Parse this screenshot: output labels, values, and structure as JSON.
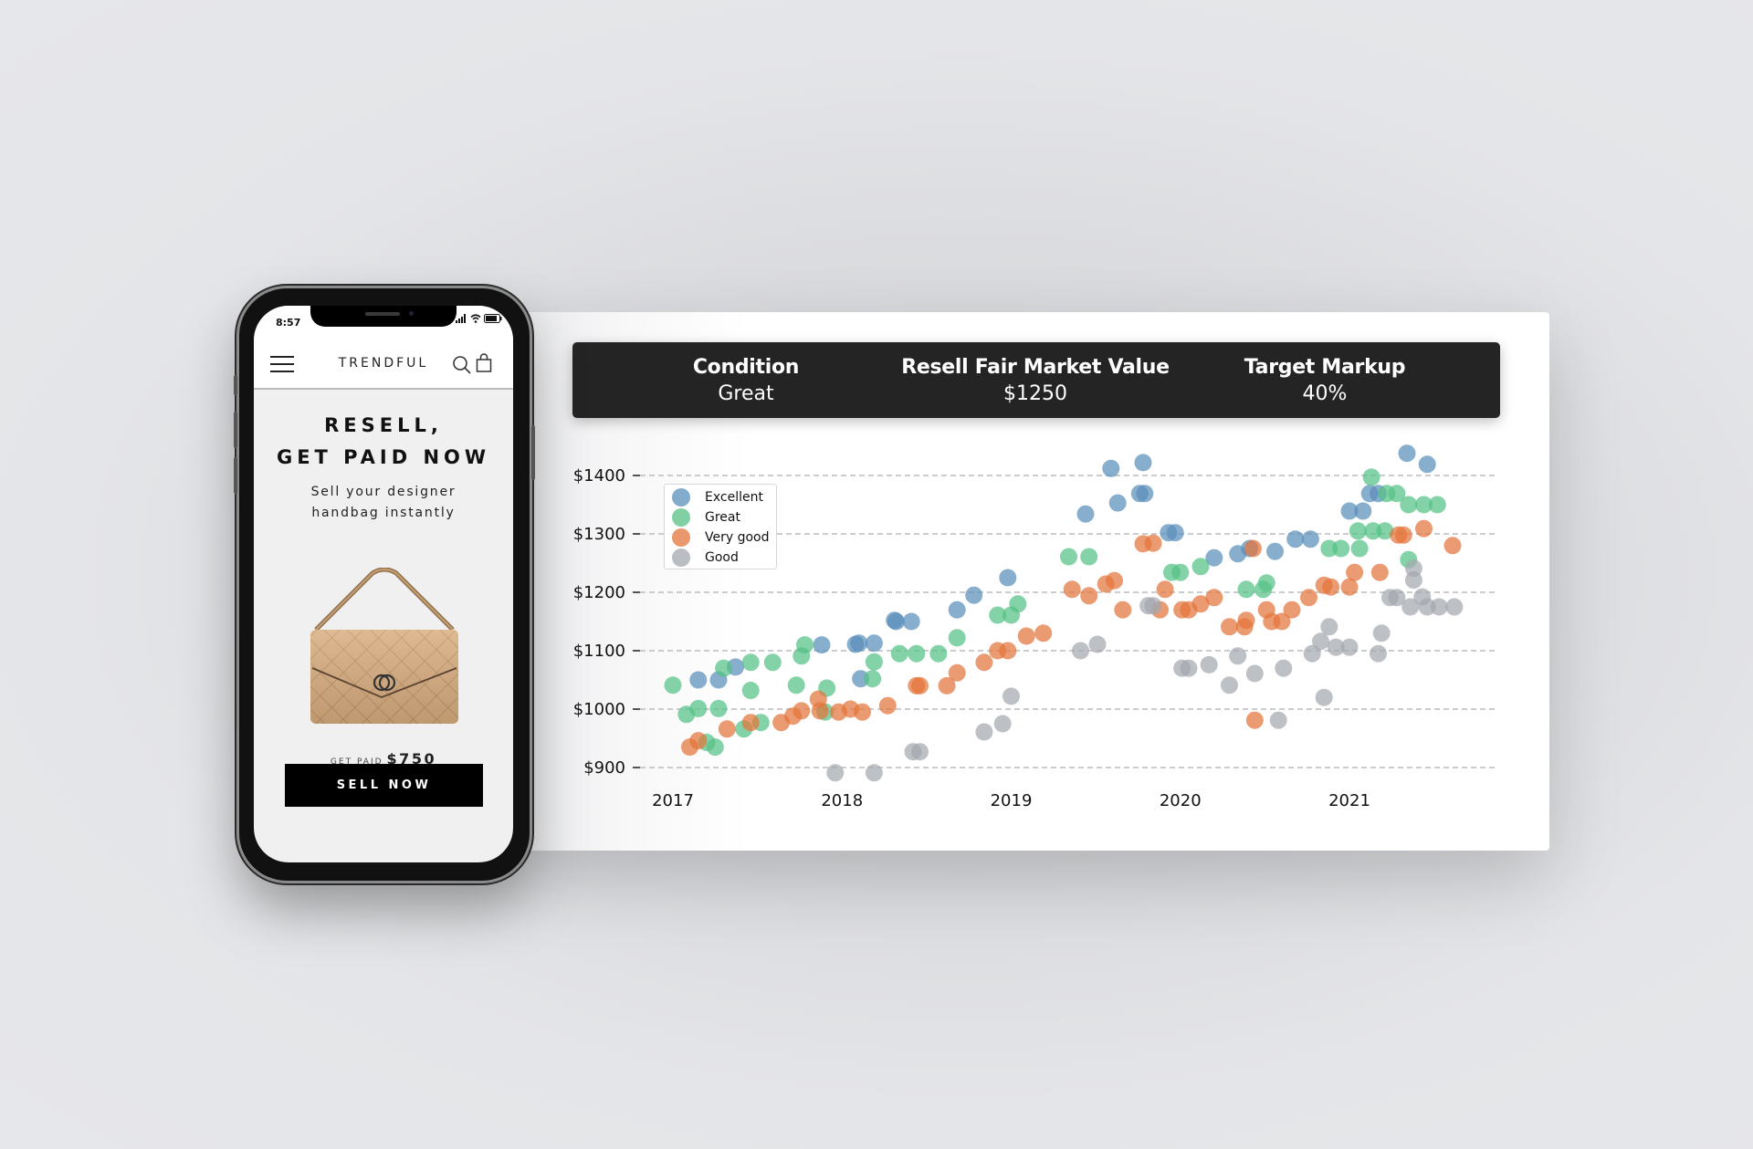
{
  "phone": {
    "status_time": "8:57",
    "icons": [
      "signal-icon",
      "wifi-icon",
      "battery-icon"
    ],
    "nav": {
      "brand": "TRENDFUL",
      "menu_icon": "hamburger-menu-icon",
      "search_icon": "search-icon",
      "bag_icon": "shopping-bag-icon"
    },
    "hero": {
      "title_line1": "RESELL,",
      "title_line2": "GET PAID NOW",
      "subtitle_line1": "Sell your designer",
      "subtitle_line2": "handbag instantly"
    },
    "product_image": "quilted-handbag-image",
    "price_label": "GET PAID",
    "price_value": "$750",
    "cta_label": "SELL NOW"
  },
  "kpis": [
    {
      "label": "Condition",
      "value": "Great"
    },
    {
      "label": "Resell Fair Market Value",
      "value": "$1250"
    },
    {
      "label": "Target Markup",
      "value": "40%"
    }
  ],
  "colors": {
    "Excellent": "#5a8fbb",
    "Great": "#55c085",
    "Very good": "#e3743a",
    "Good": "#a3a8ae",
    "kpi_bar": "#242424"
  },
  "chart_data": {
    "type": "scatter",
    "title": "",
    "xlabel": "",
    "ylabel": "",
    "x_ticks": [
      "2017",
      "2018",
      "2019",
      "2020",
      "2021"
    ],
    "x_tick_values": [
      2017,
      2018,
      2019,
      2020,
      2021
    ],
    "y_ticks": [
      "$1400",
      "$1300",
      "$1200",
      "$1100",
      "$1000",
      "$900"
    ],
    "y_tick_values": [
      1400,
      1300,
      1200,
      1100,
      1000,
      900
    ],
    "xlim": [
      2017.0,
      2021.7
    ],
    "ylim": [
      900,
      1400
    ],
    "grid": "horizontal-dashed",
    "legend_position": "top-left",
    "legend": [
      "Excellent",
      "Great",
      "Very good",
      "Good"
    ],
    "series": [
      {
        "name": "Excellent",
        "points": [
          [
            2017.15,
            1050
          ],
          [
            2017.27,
            1050
          ],
          [
            2017.37,
            1072
          ],
          [
            2017.88,
            1110
          ],
          [
            2018.08,
            1111
          ],
          [
            2018.1,
            1113
          ],
          [
            2018.19,
            1113
          ],
          [
            2018.11,
            1052
          ],
          [
            2018.31,
            1152
          ],
          [
            2018.32,
            1150
          ],
          [
            2018.41,
            1150
          ],
          [
            2018.68,
            1170
          ],
          [
            2018.78,
            1195
          ],
          [
            2018.98,
            1225
          ],
          [
            2019.44,
            1334
          ],
          [
            2019.59,
            1412
          ],
          [
            2019.63,
            1353
          ],
          [
            2019.76,
            1369
          ],
          [
            2019.79,
            1369
          ],
          [
            2019.78,
            1422
          ],
          [
            2019.93,
            1302
          ],
          [
            2019.97,
            1302
          ],
          [
            2020.2,
            1259
          ],
          [
            2020.34,
            1266
          ],
          [
            2020.41,
            1275
          ],
          [
            2020.56,
            1270
          ],
          [
            2020.68,
            1291
          ],
          [
            2020.77,
            1291
          ],
          [
            2021.0,
            1339
          ],
          [
            2021.08,
            1339
          ],
          [
            2021.12,
            1369
          ],
          [
            2021.17,
            1369
          ],
          [
            2021.34,
            1438
          ],
          [
            2021.46,
            1419
          ]
        ]
      },
      {
        "name": "Great",
        "points": [
          [
            2017.0,
            1041
          ],
          [
            2017.08,
            991
          ],
          [
            2017.15,
            1001
          ],
          [
            2017.2,
            943
          ],
          [
            2017.25,
            935
          ],
          [
            2017.27,
            1001
          ],
          [
            2017.3,
            1070
          ],
          [
            2017.42,
            966
          ],
          [
            2017.46,
            1032
          ],
          [
            2017.46,
            1080
          ],
          [
            2017.52,
            977
          ],
          [
            2017.59,
            1080
          ],
          [
            2017.73,
            1041
          ],
          [
            2017.76,
            1091
          ],
          [
            2017.78,
            1110
          ],
          [
            2017.91,
            1036
          ],
          [
            2017.9,
            995
          ],
          [
            2018.18,
            1052
          ],
          [
            2018.19,
            1081
          ],
          [
            2018.34,
            1095
          ],
          [
            2018.44,
            1095
          ],
          [
            2018.57,
            1095
          ],
          [
            2018.68,
            1122
          ],
          [
            2018.92,
            1161
          ],
          [
            2019.0,
            1161
          ],
          [
            2019.04,
            1180
          ],
          [
            2019.34,
            1261
          ],
          [
            2019.46,
            1261
          ],
          [
            2019.95,
            1234
          ],
          [
            2020.0,
            1234
          ],
          [
            2020.12,
            1244
          ],
          [
            2020.39,
            1205
          ],
          [
            2020.49,
            1205
          ],
          [
            2020.51,
            1216
          ],
          [
            2020.88,
            1275
          ],
          [
            2020.95,
            1275
          ],
          [
            2021.06,
            1275
          ],
          [
            2021.05,
            1305
          ],
          [
            2021.14,
            1305
          ],
          [
            2021.21,
            1305
          ],
          [
            2021.13,
            1397
          ],
          [
            2021.22,
            1369
          ],
          [
            2021.28,
            1369
          ],
          [
            2021.35,
            1350
          ],
          [
            2021.44,
            1350
          ],
          [
            2021.52,
            1350
          ],
          [
            2021.35,
            1256
          ]
        ]
      },
      {
        "name": "Very good",
        "points": [
          [
            2017.1,
            935
          ],
          [
            2017.15,
            946
          ],
          [
            2017.32,
            966
          ],
          [
            2017.46,
            977
          ],
          [
            2017.64,
            977
          ],
          [
            2017.71,
            988
          ],
          [
            2017.76,
            997
          ],
          [
            2017.86,
            1017
          ],
          [
            2017.87,
            997
          ],
          [
            2017.98,
            995
          ],
          [
            2018.05,
            1000
          ],
          [
            2018.12,
            995
          ],
          [
            2018.27,
            1006
          ],
          [
            2018.44,
            1040
          ],
          [
            2018.46,
            1040
          ],
          [
            2018.62,
            1040
          ],
          [
            2018.68,
            1062
          ],
          [
            2018.84,
            1080
          ],
          [
            2018.92,
            1100
          ],
          [
            2018.98,
            1100
          ],
          [
            2019.09,
            1125
          ],
          [
            2019.19,
            1130
          ],
          [
            2019.36,
            1205
          ],
          [
            2019.46,
            1194
          ],
          [
            2019.56,
            1214
          ],
          [
            2019.61,
            1220
          ],
          [
            2019.66,
            1170
          ],
          [
            2019.78,
            1283
          ],
          [
            2019.84,
            1284
          ],
          [
            2019.88,
            1170
          ],
          [
            2019.91,
            1205
          ],
          [
            2020.01,
            1170
          ],
          [
            2020.05,
            1170
          ],
          [
            2020.12,
            1180
          ],
          [
            2020.2,
            1191
          ],
          [
            2020.29,
            1141
          ],
          [
            2020.38,
            1141
          ],
          [
            2020.39,
            1152
          ],
          [
            2020.43,
            1275
          ],
          [
            2020.44,
            981
          ],
          [
            2020.51,
            1170
          ],
          [
            2020.54,
            1150
          ],
          [
            2020.6,
            1150
          ],
          [
            2020.66,
            1170
          ],
          [
            2020.76,
            1191
          ],
          [
            2020.85,
            1212
          ],
          [
            2020.89,
            1209
          ],
          [
            2021.0,
            1209
          ],
          [
            2021.03,
            1234
          ],
          [
            2021.18,
            1234
          ],
          [
            2021.29,
            1298
          ],
          [
            2021.32,
            1298
          ],
          [
            2021.44,
            1309
          ],
          [
            2021.61,
            1280
          ]
        ]
      },
      {
        "name": "Good",
        "points": [
          [
            2017.96,
            891
          ],
          [
            2018.19,
            891
          ],
          [
            2018.42,
            927
          ],
          [
            2018.46,
            927
          ],
          [
            2018.84,
            961
          ],
          [
            2018.95,
            975
          ],
          [
            2019.0,
            1022
          ],
          [
            2019.41,
            1100
          ],
          [
            2019.51,
            1111
          ],
          [
            2019.81,
            1177
          ],
          [
            2019.84,
            1177
          ],
          [
            2020.01,
            1070
          ],
          [
            2020.05,
            1070
          ],
          [
            2020.17,
            1076
          ],
          [
            2020.29,
            1041
          ],
          [
            2020.34,
            1091
          ],
          [
            2020.44,
            1061
          ],
          [
            2020.58,
            981
          ],
          [
            2020.61,
            1070
          ],
          [
            2020.78,
            1095
          ],
          [
            2020.83,
            1116
          ],
          [
            2020.85,
            1020
          ],
          [
            2020.88,
            1141
          ],
          [
            2020.92,
            1106
          ],
          [
            2021.0,
            1106
          ],
          [
            2021.17,
            1095
          ],
          [
            2021.19,
            1130
          ],
          [
            2021.24,
            1191
          ],
          [
            2021.28,
            1191
          ],
          [
            2021.36,
            1175
          ],
          [
            2021.38,
            1241
          ],
          [
            2021.38,
            1221
          ],
          [
            2021.43,
            1192
          ],
          [
            2021.46,
            1175
          ],
          [
            2021.53,
            1175
          ],
          [
            2021.62,
            1175
          ]
        ]
      }
    ]
  }
}
